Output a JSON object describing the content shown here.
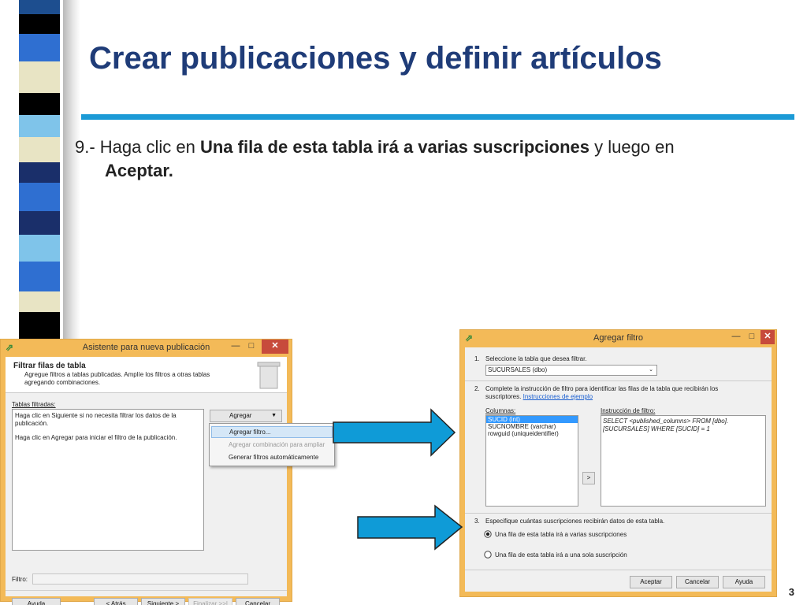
{
  "slide": {
    "title": "Crear publicaciones y definir artículos",
    "instruction_prefix": "9.- Haga clic en ",
    "instruction_bold1": "Una fila de esta tabla irá a varias suscripciones",
    "instruction_middle": " y luego en",
    "instruction_bold2": "Aceptar.",
    "page_number": "3"
  },
  "colors": {
    "title": "#1f3c78",
    "rule": "#1b9ad6",
    "window_frame": "#f3ba58",
    "close_button": "#c74b3c",
    "arrow_fill": "#0f9bd7",
    "selection": "#3399ff"
  },
  "wizard": {
    "title": "Asistente para nueva publicación",
    "header_title": "Filtrar filas de tabla",
    "header_desc": "Agregue filtros a tablas publicadas. Amplíe los filtros a otras tablas agregando combinaciones.",
    "filtered_tables_label": "Tablas filtradas:",
    "list_text_1": "Haga clic en Siguiente si no necesita filtrar los datos de la publicación.",
    "list_text_2": "Haga clic en Agregar para iniciar el filtro de la publicación.",
    "add_button": "Agregar",
    "menu": {
      "item_1": "Agregar filtro...",
      "item_2": "Agregar combinación para ampliar",
      "item_3": "Generar filtros automáticamente"
    },
    "filter_label": "Filtro:",
    "buttons": {
      "help": "Ayuda",
      "back": "< Atrás",
      "next": "Siguiente >",
      "finish": "Finalizar >>|",
      "cancel": "Cancelar"
    }
  },
  "filter_dialog": {
    "title": "Agregar filtro",
    "step1_num": "1.",
    "step1_label": "Seleccione la tabla que desea filtrar.",
    "table_select": "SUCURSALES (dbo)",
    "step2_num": "2.",
    "step2_label": "Complete la instrucción de filtro para identificar las filas de la tabla que recibirán los suscriptores.",
    "examples_link": "Instrucciones de ejemplo",
    "columns_label": "Columnas:",
    "columns": [
      "SUCID (int)",
      "SUCNOMBRE (varchar)",
      "rowguid (uniqueidentifier)"
    ],
    "move_button": ">",
    "statement_label": "Instrucción de filtro:",
    "statement_line1": "SELECT <published_columns> FROM [dbo].",
    "statement_line2": "[SUCURSALES] WHERE [SUCID] = 1",
    "step3_num": "3.",
    "step3_label": "Especifique cuántas suscripciones recibirán datos de esta tabla.",
    "radio_many": "Una fila de esta tabla irá a varias suscripciones",
    "radio_one": "Una fila de esta tabla irá a una sola suscripción",
    "buttons": {
      "accept": "Aceptar",
      "cancel": "Cancelar",
      "help": "Ayuda"
    }
  }
}
